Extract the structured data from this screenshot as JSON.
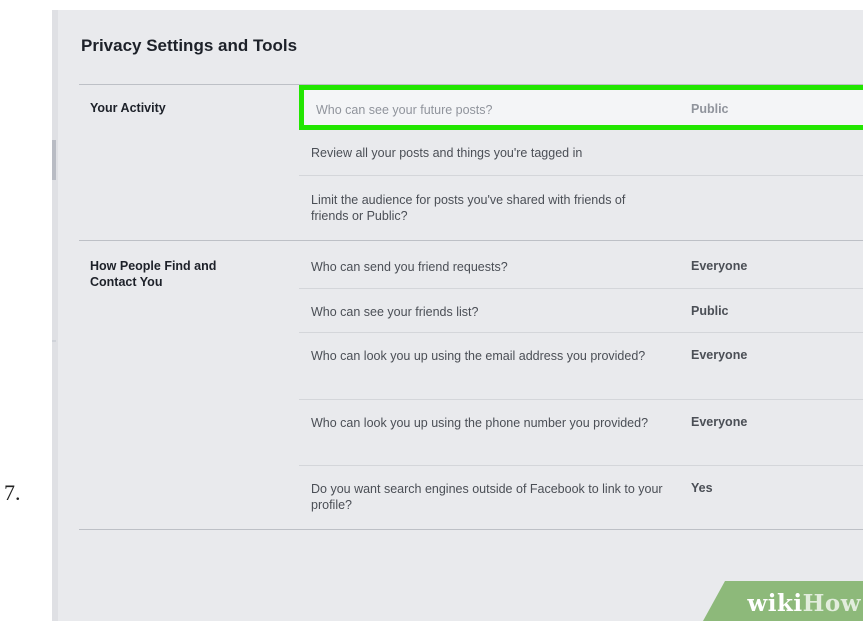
{
  "step_number": "7.",
  "page": {
    "title": "Privacy Settings and Tools"
  },
  "sections": [
    {
      "label": "Your Activity",
      "rows": [
        {
          "question": "Who can see your future posts?",
          "value": "Public",
          "highlighted": true
        },
        {
          "question": "Review all your posts and things you're tagged in",
          "value": ""
        },
        {
          "question": "Limit the audience for posts you've shared with friends of friends or Public?",
          "value": ""
        }
      ]
    },
    {
      "label": "How People Find and Contact You",
      "rows": [
        {
          "question": "Who can send you friend requests?",
          "value": "Everyone"
        },
        {
          "question": "Who can see your friends list?",
          "value": "Public"
        },
        {
          "question": "Who can look you up using the email address you provided?",
          "value": "Everyone"
        },
        {
          "question": "Who can look you up using the phone number you provided?",
          "value": "Everyone"
        },
        {
          "question": "Do you want search engines outside of Facebook to link to your profile?",
          "value": "Yes"
        }
      ]
    }
  ],
  "watermark": {
    "part1": "wiki",
    "part2": "How"
  },
  "colors": {
    "highlight_border": "#22e600",
    "panel_background": "#e9eaed",
    "watermark_green": "#8db97a"
  }
}
